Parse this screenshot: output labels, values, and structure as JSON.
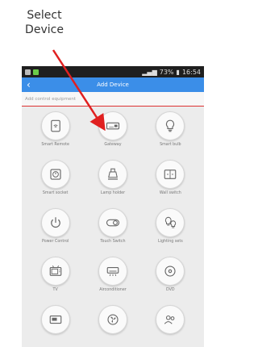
{
  "annotation": {
    "line1": "Select",
    "line2": "Device"
  },
  "status_bar": {
    "battery": "73%",
    "time": "16:54"
  },
  "header": {
    "title": "Add Device"
  },
  "subheader": {
    "text": "Add control equipment"
  },
  "devices": [
    {
      "label": "Smart Remote",
      "icon": "wifi-icon"
    },
    {
      "label": "Gateway",
      "icon": "gateway-icon"
    },
    {
      "label": "Smart bulb",
      "icon": "bulb-icon"
    },
    {
      "label": "Smart socket",
      "icon": "socket-icon"
    },
    {
      "label": "Lamp holder",
      "icon": "lamp-holder-icon"
    },
    {
      "label": "Wall switch",
      "icon": "wall-switch-icon"
    },
    {
      "label": "Power Control",
      "icon": "power-icon"
    },
    {
      "label": "Touch Switch",
      "icon": "toggle-icon"
    },
    {
      "label": "Lighting sets",
      "icon": "bulbs-icon"
    },
    {
      "label": "TV",
      "icon": "tv-icon"
    },
    {
      "label": "Airconditioner",
      "icon": "aircon-icon"
    },
    {
      "label": "DVD",
      "icon": "dvd-icon"
    }
  ]
}
